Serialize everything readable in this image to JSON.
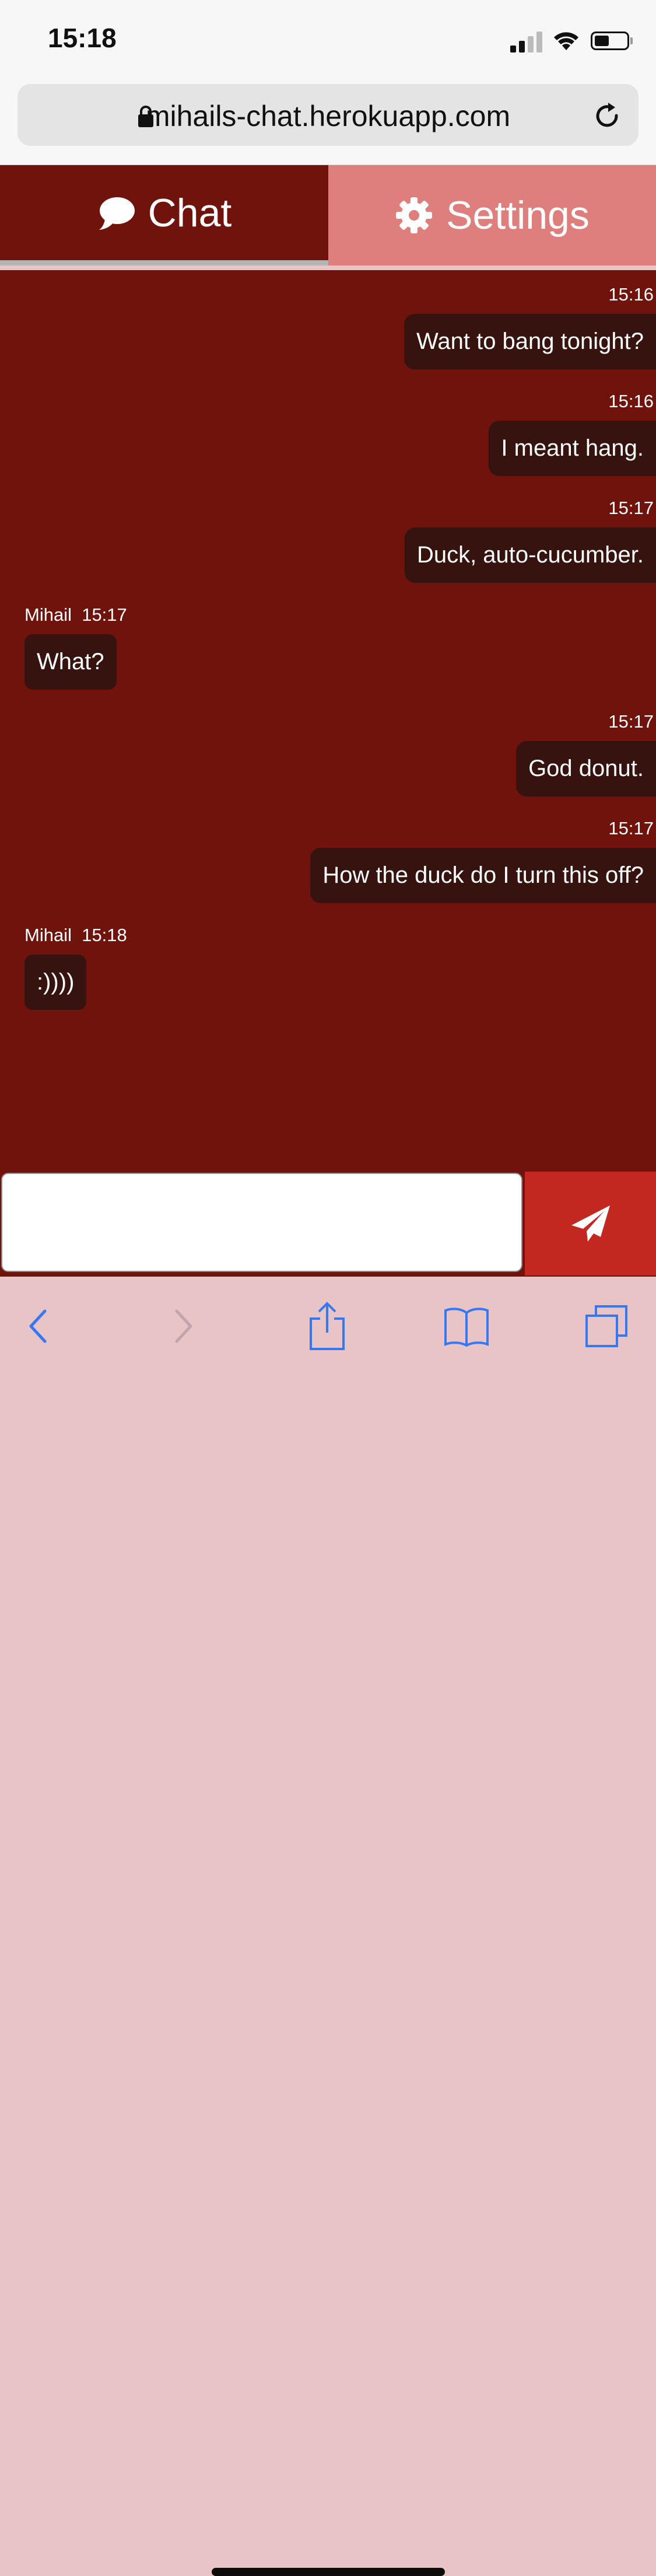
{
  "status_bar": {
    "time": "15:18"
  },
  "browser": {
    "url": "mihails-chat.herokuapp.com"
  },
  "tabs": [
    {
      "label": "Chat",
      "icon": "speech-bubble-icon",
      "active": true
    },
    {
      "label": "Settings",
      "icon": "gear-icon",
      "active": false
    }
  ],
  "messages": [
    {
      "own": true,
      "sender": "",
      "time": "15:16",
      "text": "Want to bang tonight?"
    },
    {
      "own": true,
      "sender": "",
      "time": "15:16",
      "text": "I meant hang."
    },
    {
      "own": true,
      "sender": "",
      "time": "15:17",
      "text": "Duck, auto-cucumber."
    },
    {
      "own": false,
      "sender": "Mihail",
      "time": "15:17",
      "text": "What?"
    },
    {
      "own": true,
      "sender": "",
      "time": "15:17",
      "text": "God donut."
    },
    {
      "own": true,
      "sender": "",
      "time": "15:17",
      "text": "How the duck do I turn this off?"
    },
    {
      "own": false,
      "sender": "Mihail",
      "time": "15:18",
      "text": ":))))"
    }
  ],
  "composer": {
    "value": "",
    "placeholder": "",
    "send_icon": "paper-plane-icon"
  },
  "toolbar": {
    "icons": [
      "back-chevron-icon",
      "forward-chevron-icon",
      "share-icon",
      "bookmarks-icon",
      "tabs-icon"
    ]
  },
  "colors": {
    "chat_background": "#70130d",
    "bubble": "#36130f",
    "tab_active": "#70130d",
    "tab_inactive": "#df7f7d",
    "send_button": "#c2281f",
    "toolbar_background": "#e8c4c6",
    "toolbar_icon": "#3478f6"
  }
}
